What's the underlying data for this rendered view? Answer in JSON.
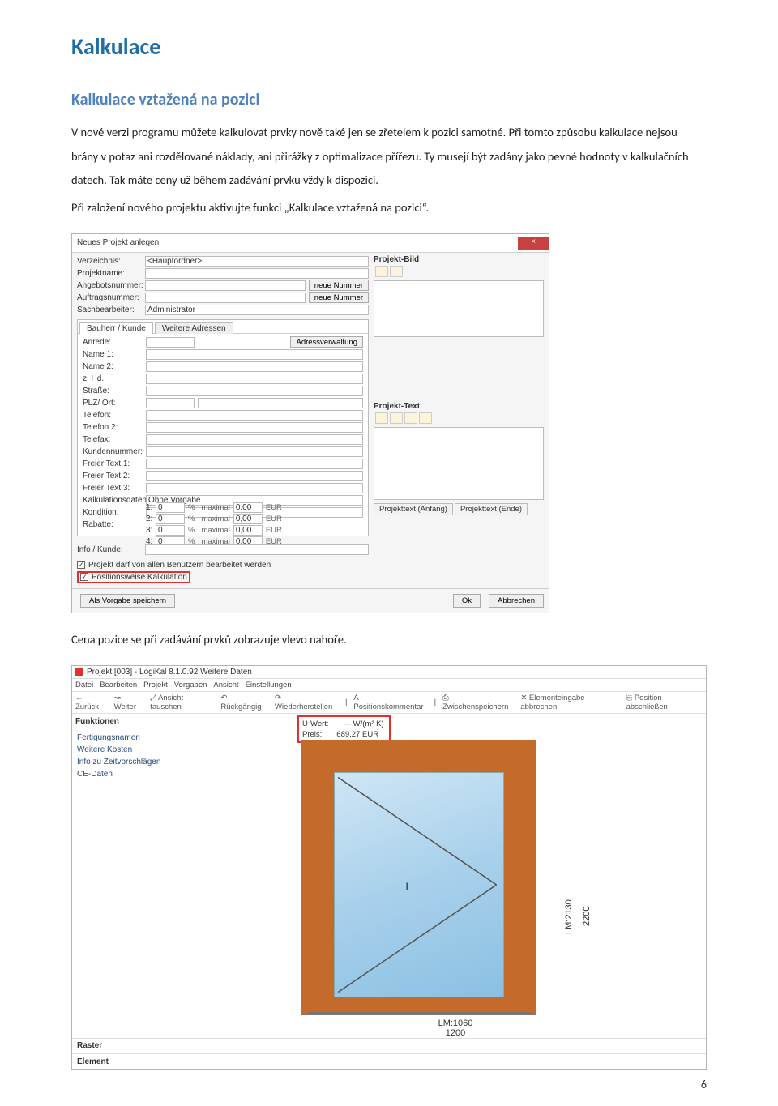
{
  "heading": "Kalkulace",
  "subheading": "Kalkulace vztažená na pozici",
  "para1": "V nové verzi programu můžete kalkulovat prvky nově také jen se zřetelem k pozici samotné. Při tomto způsobu kalkulace nejsou brány v potaz ani rozdělované náklady, ani přirážky z optimalizace přířezu. Ty musejí být zadány jako pevné hodnoty v kalkulačních datech. Tak máte ceny už během zadávání prvku vždy k dispozici.",
  "para2": "Při založení nového projektu aktivujte funkci „Kalkulace vztažená na pozici“.",
  "para3": "Cena pozice se při zadávání prvků zobrazuje vlevo nahoře.",
  "dialog": {
    "title": "Neues Projekt anlegen",
    "close": "×",
    "labels": {
      "verzeichnis": "Verzeichnis:",
      "projektname": "Projektname:",
      "angebotsnummer": "Angebotsnummer:",
      "auftragsnummer": "Auftragsnummer:",
      "sachbearbeiter": "Sachbearbeiter:"
    },
    "values": {
      "verzeichnis": "<Hauptordner>",
      "sachbearbeiter": "Administrator"
    },
    "btn_neue_nummer": "neue Nummer",
    "tabs": {
      "bauherr": "Bauherr / Kunde",
      "weitere": "Weitere Adressen"
    },
    "btn_adress": "Adressverwaltung",
    "kundeLabels": {
      "anrede": "Anrede:",
      "name1": "Name 1:",
      "name2": "Name 2:",
      "zhd": "z. Hd.:",
      "strasse": "Straße:",
      "plz": "PLZ/ Ort:",
      "telefon": "Telefon:",
      "telefon2": "Telefon 2:",
      "telefax": "Telefax:",
      "kundennummer": "Kundennummer:",
      "ft1": "Freier Text 1:",
      "ft2": "Freier Text 2:",
      "ft3": "Freier Text 3:",
      "kalk": "Kalkulationsdaten:",
      "kondition": "Kondition:",
      "rabatte": "Rabatte:"
    },
    "kalkValue": "Ohne Vorgabe",
    "rabatte": [
      {
        "n": "1:",
        "v": "0",
        "max": "maximal",
        "cur": "0,00",
        "eur": "EUR"
      },
      {
        "n": "2:",
        "v": "0",
        "max": "maximal",
        "cur": "0,00",
        "eur": "EUR"
      },
      {
        "n": "3:",
        "v": "0",
        "max": "maximal",
        "cur": "0,00",
        "eur": "EUR"
      },
      {
        "n": "4:",
        "v": "0",
        "max": "maximal",
        "cur": "0,00",
        "eur": "EUR"
      }
    ],
    "pct": "%",
    "rightPanels": {
      "bild": "Projekt-Bild",
      "text": "Projekt-Text"
    },
    "info": "Info / Kunde:",
    "checks": {
      "alle": "Projekt darf von allen Benutzern bearbeitet werden",
      "positionsweise": "Positionsweise Kalkulation"
    },
    "bottomTabs": {
      "anfang": "Projekttext (Anfang)",
      "ende": "Projekttext (Ende)"
    },
    "footer": {
      "save": "Als Vorgabe speichern",
      "ok": "Ok",
      "abbrechen": "Abbrechen"
    }
  },
  "window2": {
    "title": "Projekt [003] - LogiKal 8.1.0.92 Weitere Daten",
    "menu": [
      "Datei",
      "Bearbeiten",
      "Projekt",
      "Vorgaben",
      "Ansicht",
      "Einstellungen"
    ],
    "toolbar": {
      "zuruck": "← Zurück",
      "weiter": "↝ Weiter",
      "ansicht": "⤢ Ansicht tauschen",
      "ruck": "↶ Rückgängig",
      "wied": "↷ Wiederherstellen",
      "poskomm": "A   Positionskommentar",
      "zwischen": "⎙ Zwischenspeichern",
      "elemabbr": "✕ Elementeingabe abbrechen",
      "posabsch": "⎘ Position abschließen"
    },
    "sidebar": {
      "header": "Funktionen",
      "items": [
        "Fertigungsnamen",
        "Weitere Kosten",
        "Info zu Zeitvorschlägen",
        "CE-Daten"
      ]
    },
    "priceBox": {
      "uw_label": "U-Wert:",
      "uw_value": "— W/(m² K)",
      "preis_label": "Preis:",
      "preis_value": "689,27 EUR"
    },
    "glassLabel": "L",
    "dims": {
      "lmw": "LM:1060",
      "w": "1200",
      "lmh": "LM:2130",
      "h": "2200"
    },
    "bottomItems": [
      "Raster",
      "Element"
    ]
  },
  "pageNumber": "6"
}
